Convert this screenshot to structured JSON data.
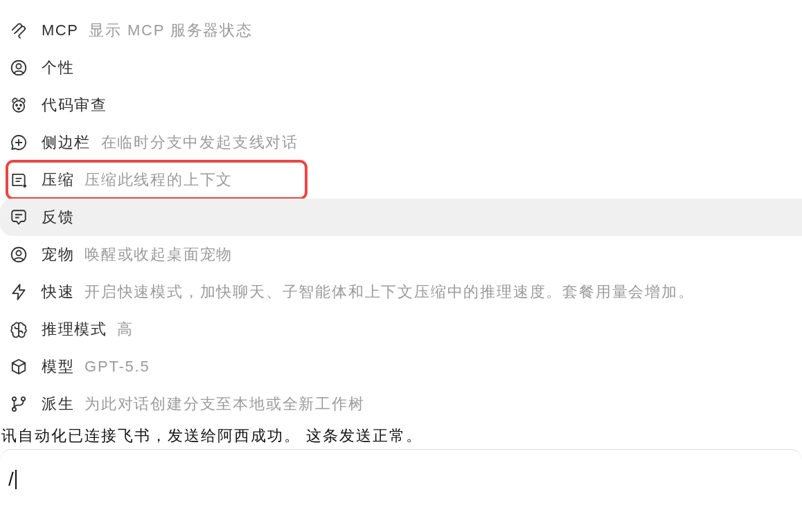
{
  "command_menu": {
    "items": [
      {
        "label": "MCP",
        "description": "显示 MCP 服务器状态",
        "selected": false,
        "outlined": false
      },
      {
        "label": "个性",
        "selected": false,
        "outlined": false
      },
      {
        "label": "代码审查",
        "selected": false,
        "outlined": false
      },
      {
        "label": "侧边栏",
        "description": "在临时分支中发起支线对话",
        "selected": false,
        "outlined": false
      },
      {
        "label": "压缩",
        "description": "压缩此线程的上下文",
        "selected": false,
        "outlined": true
      },
      {
        "label": "反馈",
        "selected": true,
        "outlined": false
      },
      {
        "label": "宠物",
        "description": "唤醒或收起桌面宠物",
        "selected": false,
        "outlined": false
      },
      {
        "label": "快速",
        "description": "开启快速模式，加快聊天、子智能体和上下文压缩中的推理速度。套餐用量会增加。",
        "selected": false,
        "outlined": false
      },
      {
        "label": "推理模式",
        "description": "高",
        "selected": false,
        "outlined": false
      },
      {
        "label": "模型",
        "description": "GPT-5.5",
        "selected": false,
        "outlined": false
      },
      {
        "label": "派生",
        "description": "为此对话创建分支至本地或全新工作树",
        "selected": false,
        "outlined": false
      }
    ]
  },
  "chat": {
    "message": "讯自动化已连接飞书，发送给阿西成功。 这条发送正常。"
  },
  "composer": {
    "value": "/"
  }
}
